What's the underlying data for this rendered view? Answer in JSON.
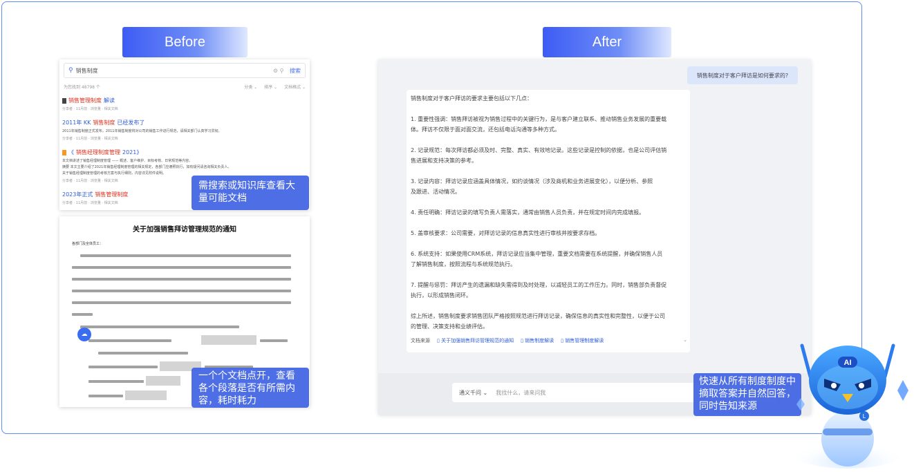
{
  "labels": {
    "before": "Before",
    "after": "After"
  },
  "search": {
    "query": "销售制度",
    "search_button": "搜索",
    "count_text": "为您找到 48798 个",
    "filters": [
      "分类 ⌄",
      "排序 ⌄",
      "文档格式 ⌄"
    ]
  },
  "results": [
    {
      "title_hl": "销售管理制度",
      "title_rest": "解读",
      "meta": "分享者 · 11月前 · 浏览量 · 相关文档",
      "orange": false
    },
    {
      "title_pre": "2011年 KK",
      "title_hl": "销售制度",
      "title_rest": "已经发布了",
      "snippet": "2011年销售制度正式发布，2011年销售制度将对公司的销售工作进行规范，请相关部门认真学习贯彻。",
      "meta": "分享者 · 11月前 · 浏览量 · 相关文档",
      "orange": false
    },
    {
      "title_pre": "《",
      "title_hl": "销售经理制度管理",
      "title_rest": "2021》",
      "snippet1": "本文档讲述了销售经理制度管理 —— 概述、客户维护、目标考核、日常规范等内容。",
      "snippet2": "摘要 本文主要介绍了2021年销售经理制度管理的相关规定，各部门应遵照执行，如有疑问请咨询相关负责人。",
      "snippet3": "关于销售经理制度管理的考核方案与执行细则，内容详见附件说明。",
      "meta": "分享者 · 11月前 · 浏览量 · 相关文档",
      "orange": true
    },
    {
      "title_pre": "2023年正式",
      "title_hl": "销售管理制度",
      "title_rest": "",
      "meta": "分享者 · 11月前 · 浏览量 · 相关文档",
      "orange": false
    }
  ],
  "callouts": {
    "before_top": "需搜索或知识库查看大量可能文档",
    "before_bottom": "一个个文档点开，查看各个段落是否有所需内容，耗时耗力",
    "after": "快速从所有制度制度中摘取答案并自然回答，同时告知来源"
  },
  "doc": {
    "title": "关于加强销售拜访管理规范的通知",
    "greeting": "各部门及全体员工："
  },
  "chat": {
    "question": "销售制度对于客户拜访是如何要求的?",
    "answer_lines": [
      "销售制度对于客户拜访的要求主要包括以下几点：",
      "",
      "1. 重要性强调：销售拜访被视为销售过程中的关键行为，是与客户建立联系、推动销售业务发展的重要载",
      "体。拜访不仅限于面对面交流，还包括电话沟通等多种方式。",
      "",
      "2. 记录规范：每次拜访都必须及时、完整、真实、有效地记录。这些记录是控制的依据，也是公司评估销",
      "售进展和支持决策的参考。",
      "",
      "3. 记录内容：拜访记录应涵盖具体情况，如约谈情况（涉及商机和业务进展变化），以便分析、参照",
      "及跟进、活动情况。",
      "",
      "4. 责任明确：拜访记录的填写负责人需落实，通常由销售人员负责，并在规定时间内完成填报。",
      "",
      "5. 盖审核要求：公司需要，对拜访记录的信息真实性进行审核并按要求存档。",
      "",
      "6. 系统支持：如果使用CRM系统，拜访记录应当集中管理，重要文档需要在系统提醒，并确保销售人员",
      "了解销售制度，按照流程与系统规范执行。",
      "",
      "7. 提醒与惩罚：拜访产生的遗漏和缺失需得到及时处理，以减轻员工的工作压力。同时，销售部负责督促",
      "执行，以形成销售闭环。",
      "",
      "综上所述，销售制度要求销售团队严格按照规范进行拜访记录，确保信息的真实性和完整性，以便于公司",
      "的管理、决策支持和业绩评估。"
    ],
    "sources_label": "文档来源",
    "sources": [
      "关于加强销售拜访管理规范的通知",
      "销售制度解读",
      "销售管理制度解读"
    ],
    "input_mode": "通义千问 ⌄",
    "input_placeholder": "我找什么，请来问我",
    "chat_icon": "chat-bubble-icon"
  },
  "robot": {
    "badge": "AI",
    "chest": "L"
  },
  "colors": {
    "accent": "#3d5cf5",
    "callout": "#3e62e2",
    "frame": "#5b8cf0"
  }
}
